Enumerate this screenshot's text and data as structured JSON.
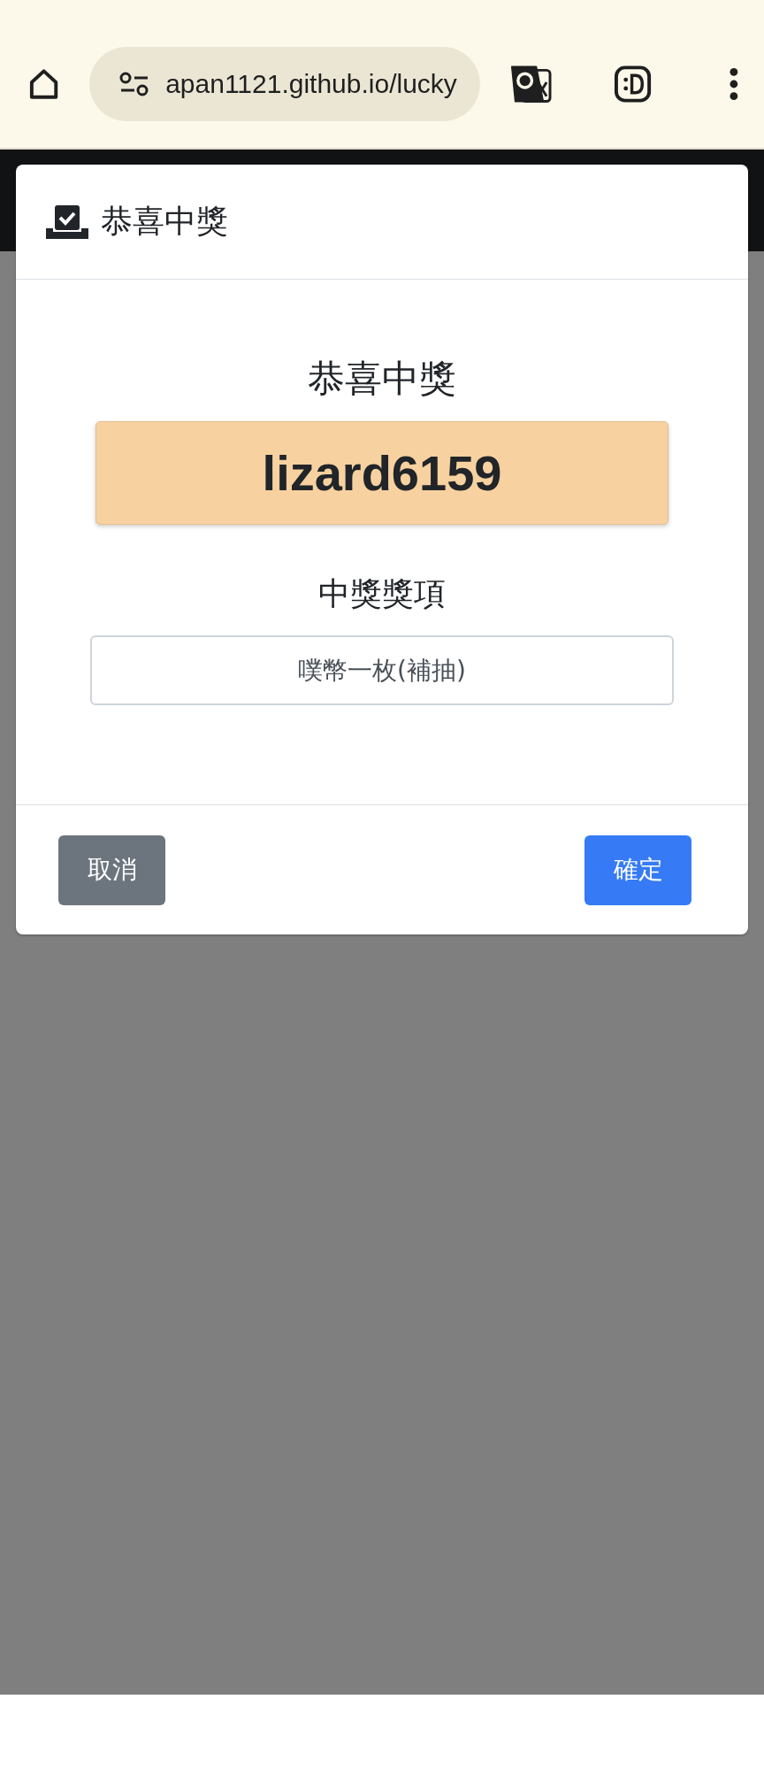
{
  "browser": {
    "url": "apan1121.github.io/lucky"
  },
  "modal": {
    "title": "恭喜中獎",
    "heading": "恭喜中獎",
    "winner": "lizard6159",
    "prize_label": "中獎獎項",
    "prize_value": "噗幣一枚(補抽)",
    "buttons": [
      {
        "label": "取消",
        "kind": "secondary"
      },
      {
        "label": "確定",
        "kind": "primary"
      }
    ]
  }
}
